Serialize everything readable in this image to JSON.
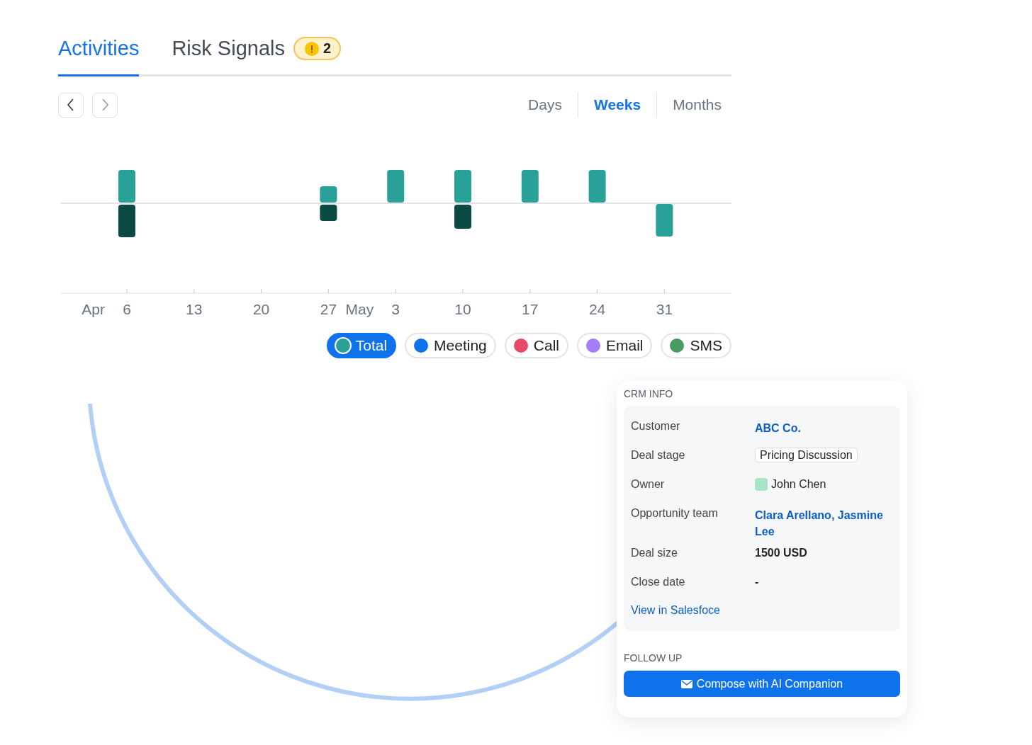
{
  "tabs": [
    {
      "label": "Activities",
      "selected": true
    },
    {
      "label": "Risk Signals",
      "selected": false,
      "badge": "2"
    }
  ],
  "ranges": [
    {
      "label": "Days",
      "selected": false
    },
    {
      "label": "Weeks",
      "selected": true
    },
    {
      "label": "Months",
      "selected": false
    }
  ],
  "chart": {
    "ticks": [
      "6",
      "13",
      "20",
      "27",
      "3",
      "10",
      "17",
      "24",
      "31"
    ],
    "months": [
      "Apr",
      "May"
    ]
  },
  "legend": [
    {
      "label": "Total",
      "selected": true,
      "color": "#2aa198"
    },
    {
      "label": "Meeting",
      "selected": false,
      "color": "#0e72ed"
    },
    {
      "label": "Call",
      "selected": false,
      "color": "#e84a67"
    },
    {
      "label": "Email",
      "selected": false,
      "color": "#a67cf7"
    },
    {
      "label": "SMS",
      "selected": false,
      "color": "#4a9a64"
    }
  ],
  "crm": {
    "title": "CRM INFO",
    "rows": [
      {
        "label": "Customer",
        "value": "ABC Co.",
        "kind": "link"
      },
      {
        "label": "Deal stage",
        "value": "Pricing Discussion",
        "kind": "tag"
      },
      {
        "label": "Owner",
        "value": "John Chen",
        "kind": "person"
      },
      {
        "label": "Opportunity team",
        "value": "Clara Arellano, Jasmine Lee",
        "kind": "link"
      },
      {
        "label": "Deal size",
        "value": "1500 USD",
        "kind": "text"
      },
      {
        "label": "Close date",
        "value": "-",
        "kind": "text"
      }
    ],
    "link": "View in Salesfoce"
  },
  "follow_up": {
    "title": "FOLLOW UP",
    "button": "Compose with AI Companion"
  }
}
